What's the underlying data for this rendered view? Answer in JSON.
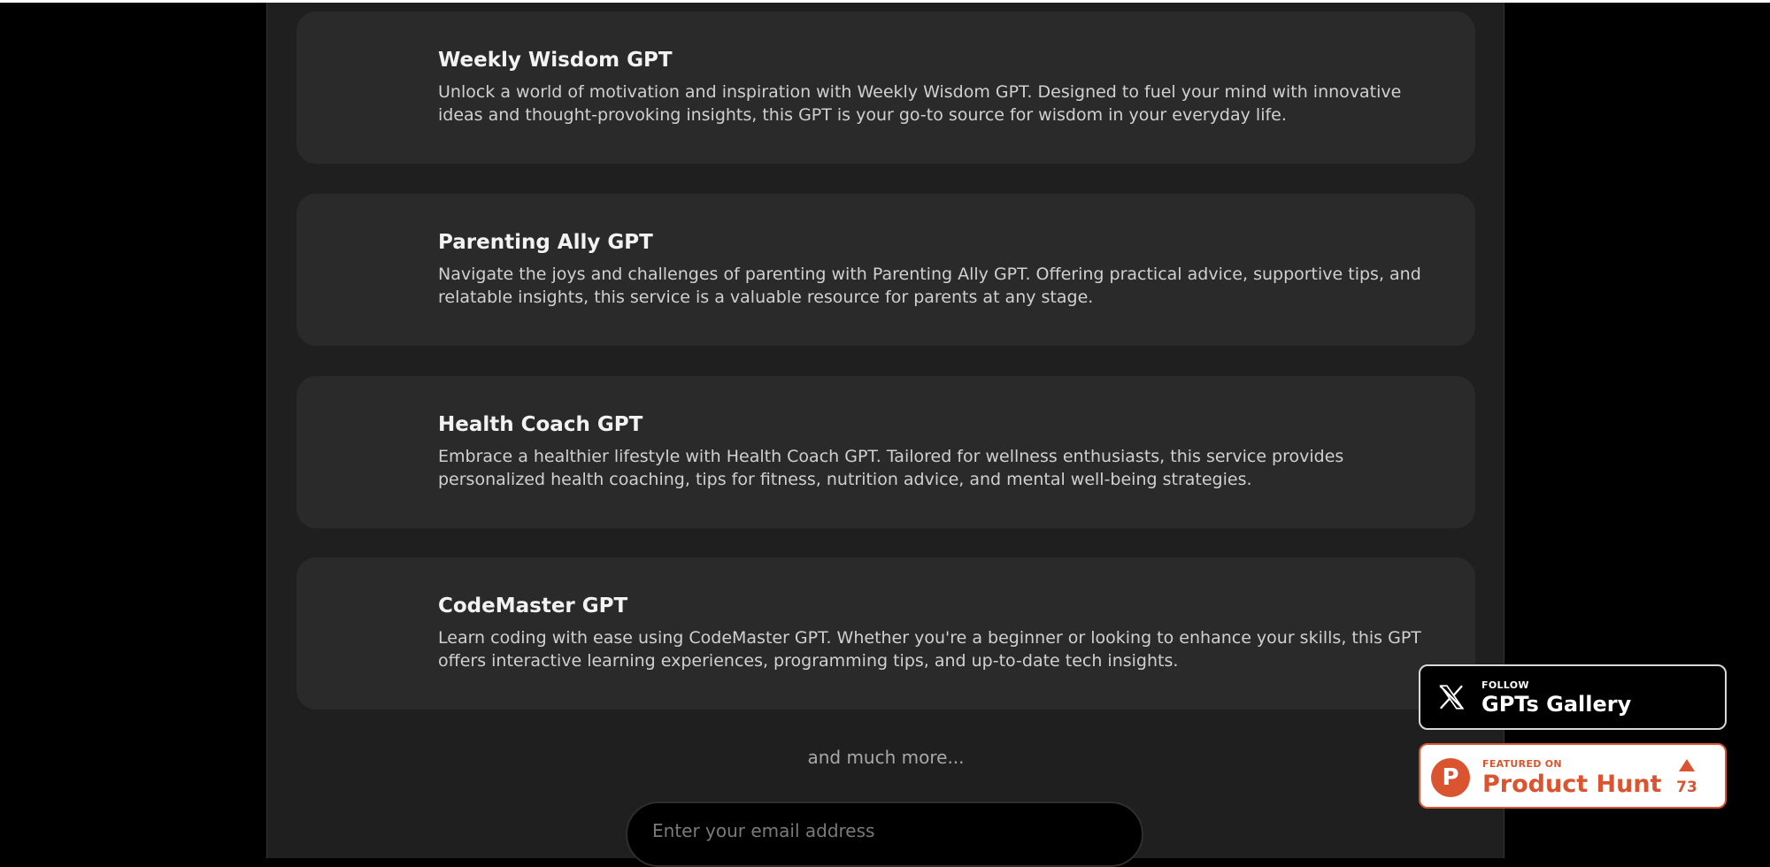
{
  "colors": {
    "page_background": "#000000",
    "panel_background": "#1f1f1f",
    "card_background": "#2a2a2a",
    "product_hunt_accent": "#da552f"
  },
  "cards": [
    {
      "title": "Weekly Wisdom GPT",
      "description": "Unlock a world of motivation and inspiration with Weekly Wisdom GPT. Designed to fuel your mind with innovative ideas and thought-provoking insights, this GPT is your go-to source for wisdom in your everyday life."
    },
    {
      "title": "Parenting Ally GPT",
      "description": "Navigate the joys and challenges of parenting with Parenting Ally GPT. Offering practical advice, supportive tips, and relatable insights, this service is a valuable resource for parents at any stage."
    },
    {
      "title": "Health Coach GPT",
      "description": "Embrace a healthier lifestyle with Health Coach GPT. Tailored for wellness enthusiasts, this service provides personalized health coaching, tips for fitness, nutrition advice, and mental well-being strategies."
    },
    {
      "title": "CodeMaster GPT",
      "description": "Learn coding with ease using CodeMaster GPT. Whether you're a beginner or looking to enhance your skills, this GPT offers interactive learning experiences, programming tips, and up-to-date tech insights."
    }
  ],
  "more_text": "and much more...",
  "email_input": {
    "placeholder": "Enter your email address",
    "value": ""
  },
  "x_badge": {
    "icon": "x-logo-icon",
    "small_label": "FOLLOW",
    "big_label": "GPTs Gallery"
  },
  "product_hunt_badge": {
    "icon": "product-hunt-logo-icon",
    "logo_letter": "P",
    "small_label": "FEATURED ON",
    "big_label": "Product Hunt",
    "upvote_icon": "upvote-triangle-icon",
    "upvote_count": "73"
  }
}
